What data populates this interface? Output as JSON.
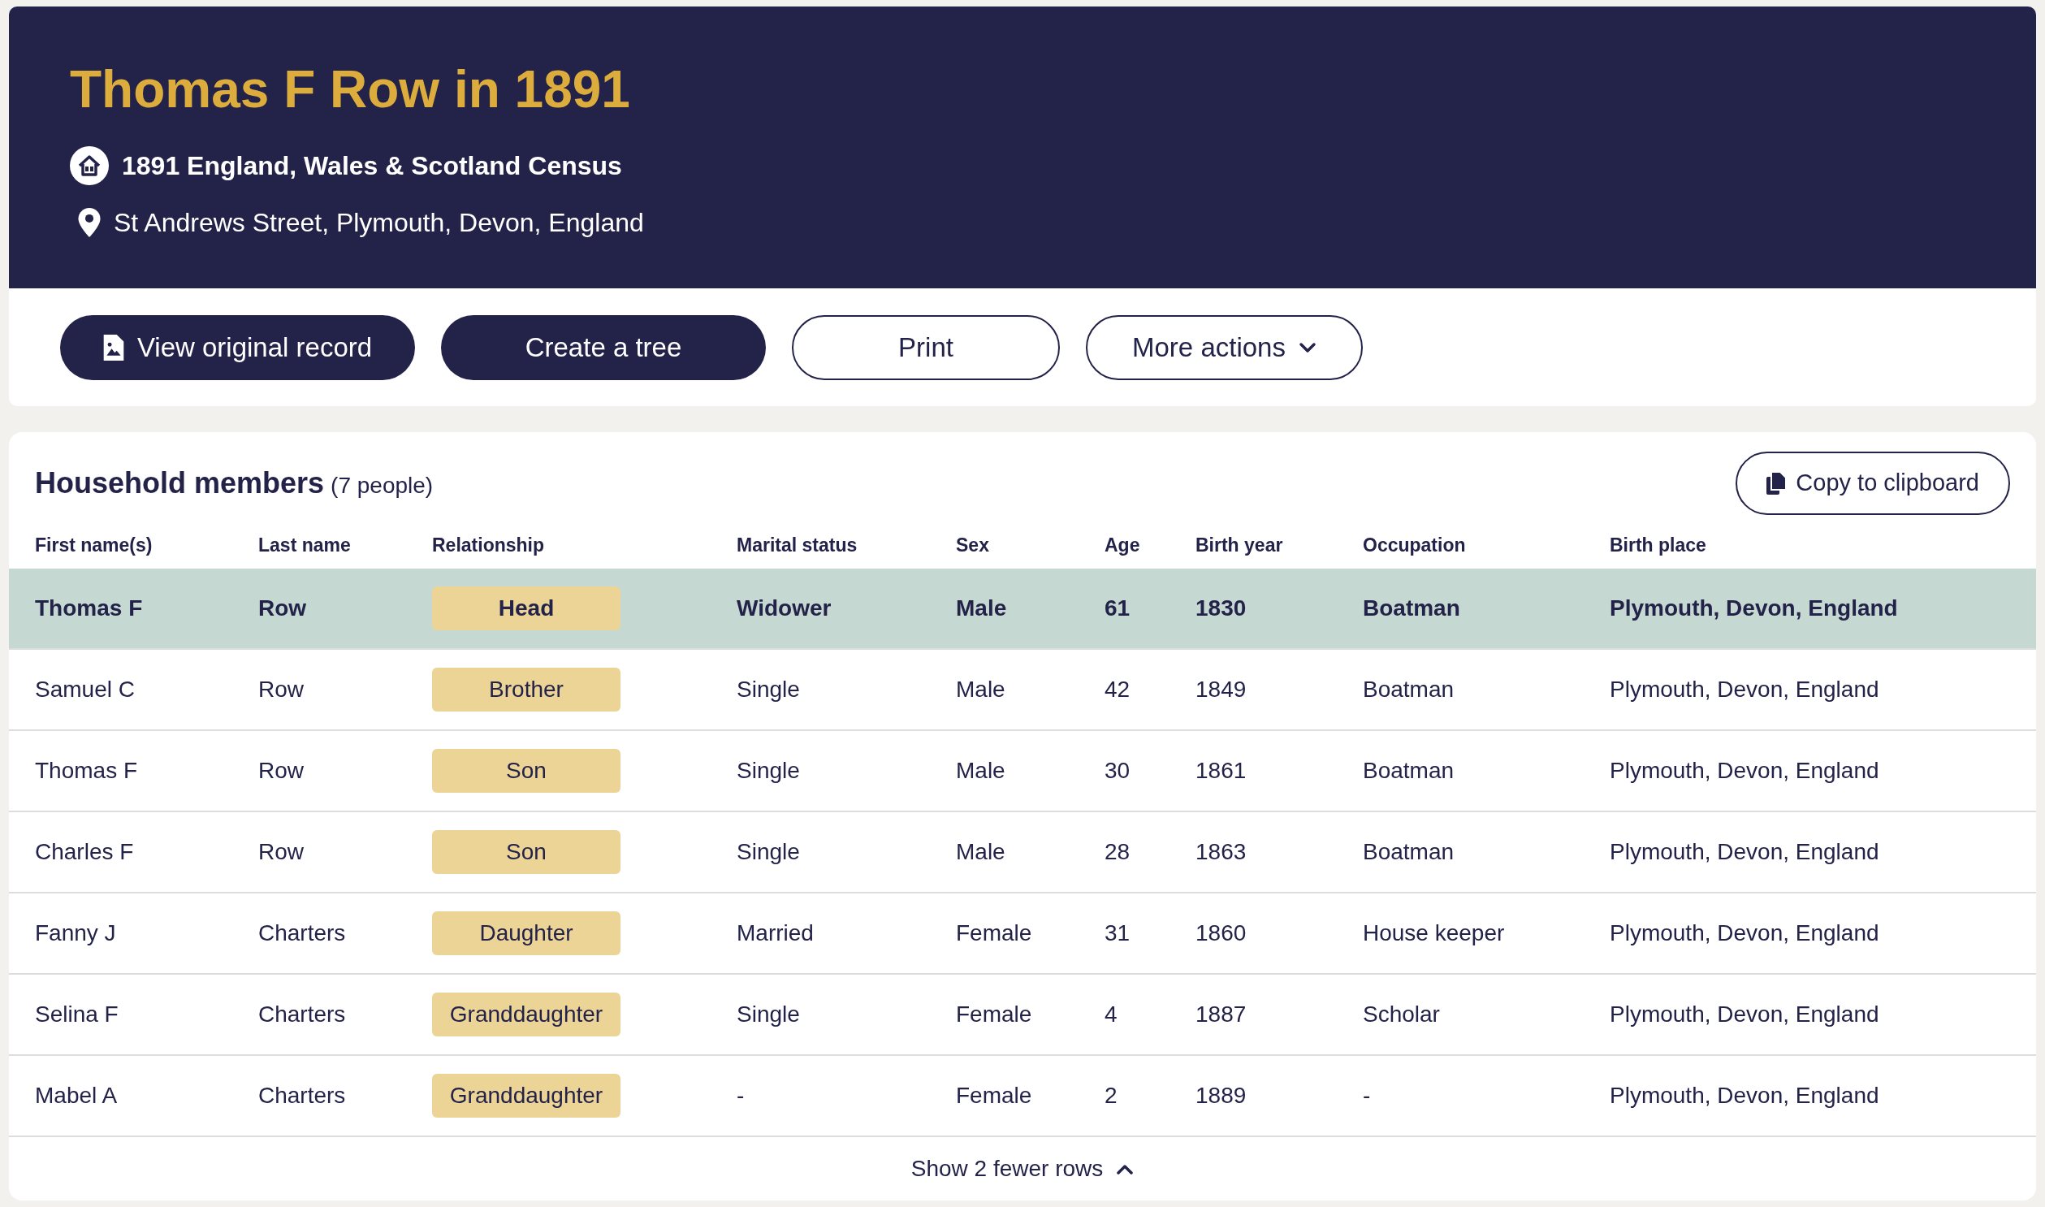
{
  "header": {
    "title": "Thomas F Row in 1891",
    "collection": "1891 England, Wales & Scotland Census",
    "location": "St Andrews Street, Plymouth, Devon, England"
  },
  "actions": [
    {
      "label": "View original record",
      "kind": "primary-icon"
    },
    {
      "label": "Create a tree",
      "kind": "primary"
    },
    {
      "label": "Print",
      "kind": "outline"
    },
    {
      "label": "More actions",
      "kind": "dropdown"
    }
  ],
  "household": {
    "title": "Household members",
    "count": "(7 people)",
    "copy_button": "Copy to clipboard",
    "columns": [
      "First name(s)",
      "Last name",
      "Relationship",
      "Marital status",
      "Sex",
      "Age",
      "Birth year",
      "Occupation",
      "Birth place"
    ],
    "rows": [
      {
        "selected": true,
        "cells": [
          "Thomas F",
          "Row",
          "Head",
          "Widower",
          "Male",
          "61",
          "1830",
          "Boatman",
          "Plymouth, Devon, England"
        ]
      },
      {
        "selected": false,
        "cells": [
          "Samuel C",
          "Row",
          "Brother",
          "Single",
          "Male",
          "42",
          "1849",
          "Boatman",
          "Plymouth, Devon, England"
        ]
      },
      {
        "selected": false,
        "cells": [
          "Thomas F",
          "Row",
          "Son",
          "Single",
          "Male",
          "30",
          "1861",
          "Boatman",
          "Plymouth, Devon, England"
        ]
      },
      {
        "selected": false,
        "cells": [
          "Charles F",
          "Row",
          "Son",
          "Single",
          "Male",
          "28",
          "1863",
          "Boatman",
          "Plymouth, Devon, England"
        ]
      },
      {
        "selected": false,
        "cells": [
          "Fanny J",
          "Charters",
          "Daughter",
          "Married",
          "Female",
          "31",
          "1860",
          "House keeper",
          "Plymouth, Devon, England"
        ]
      },
      {
        "selected": false,
        "cells": [
          "Selina F",
          "Charters",
          "Granddaughter",
          "Single",
          "Female",
          "4",
          "1887",
          "Scholar",
          "Plymouth, Devon, England"
        ]
      },
      {
        "selected": false,
        "cells": [
          "Mabel A",
          "Charters",
          "Granddaughter",
          "-",
          "Female",
          "2",
          "1889",
          "-",
          "Plymouth, Devon, England"
        ]
      }
    ],
    "toggle": "Show 2 fewer rows"
  }
}
